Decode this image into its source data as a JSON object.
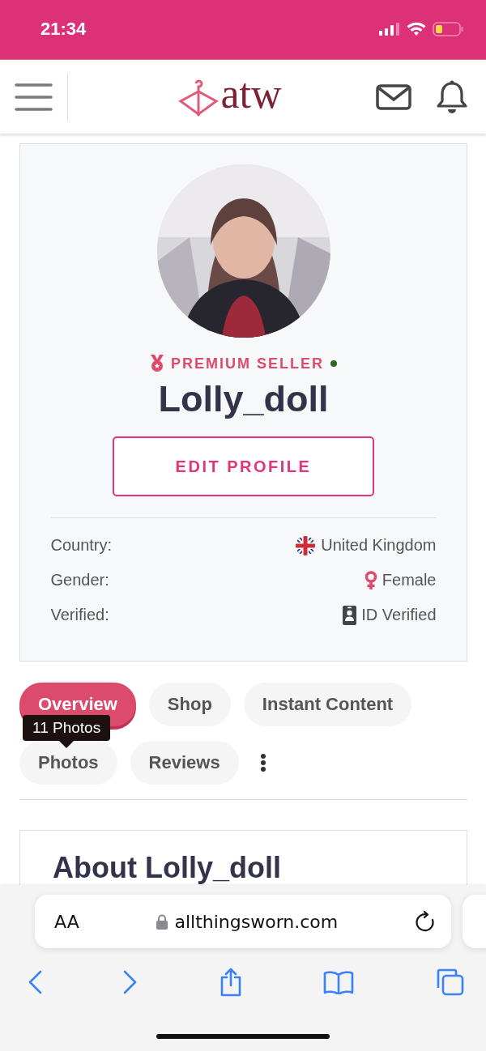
{
  "status_bar": {
    "time": "21:34"
  },
  "header": {
    "logo_text": "atw"
  },
  "profile": {
    "badge": "PREMIUM SELLER",
    "online": true,
    "username": "Lolly_doll",
    "edit_button": "EDIT PROFILE",
    "details": [
      {
        "label": "Country:",
        "value": "United Kingdom",
        "kind": "flag"
      },
      {
        "label": "Gender:",
        "value": "Female",
        "kind": "gender"
      },
      {
        "label": "Verified:",
        "value": "ID Verified",
        "kind": "id"
      }
    ]
  },
  "tabs": [
    {
      "label": "Overview",
      "selected": true
    },
    {
      "label": "Shop",
      "selected": false
    },
    {
      "label": "Instant Content",
      "selected": false
    },
    {
      "label": "Photos",
      "selected": false
    },
    {
      "label": "Reviews",
      "selected": false
    }
  ],
  "tooltip": {
    "text": "11 Photos"
  },
  "about": {
    "title": "About Lolly_doll"
  },
  "browser": {
    "text_size": "AA",
    "url": "allthingsworn.com"
  }
}
